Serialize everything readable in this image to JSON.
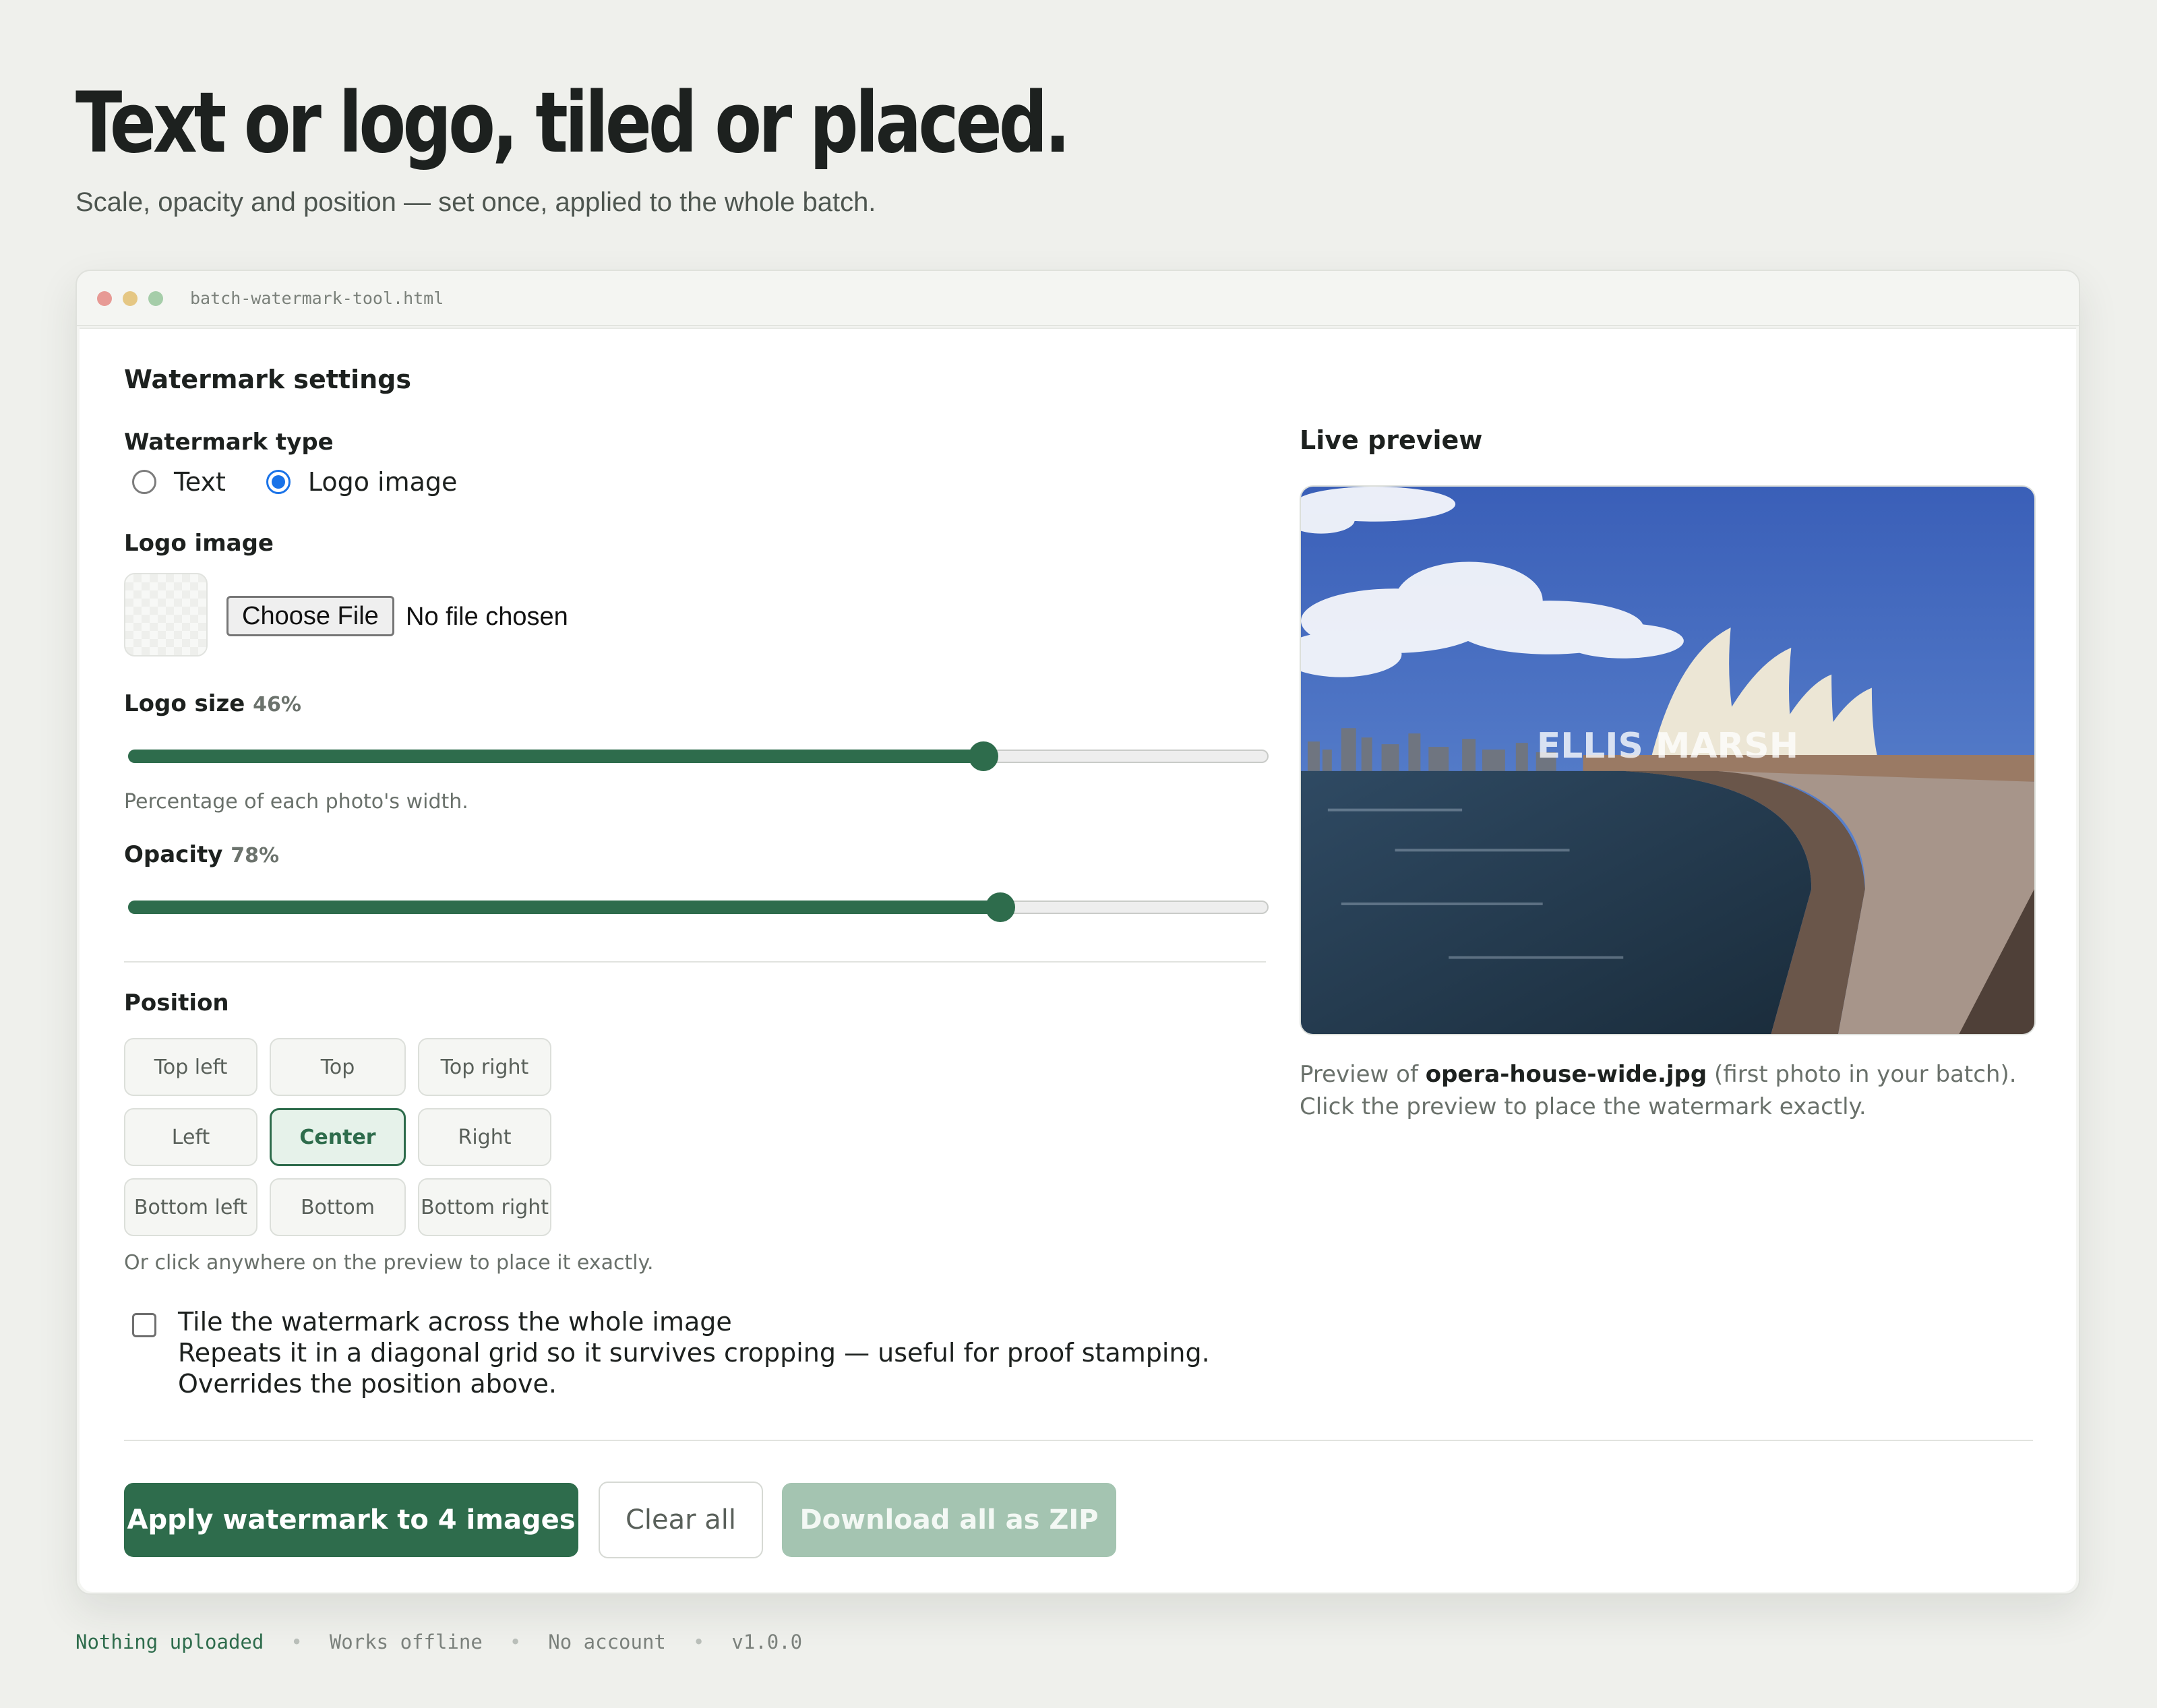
{
  "hero": {
    "title": "Text or logo, tiled or placed.",
    "subtitle": "Scale, opacity and position — set once, applied to the whole batch."
  },
  "window": {
    "title": "batch-watermark-tool.html"
  },
  "settings": {
    "heading": "Watermark settings",
    "type_label": "Watermark type",
    "type_options": [
      {
        "label": "Text",
        "selected": false
      },
      {
        "label": "Logo image",
        "selected": true
      }
    ],
    "logo_label": "Logo image",
    "file_button": "Choose File",
    "file_status": "No file chosen",
    "size_label": "Logo size",
    "size_value": "46%",
    "size_fraction": 0.75,
    "size_help": "Percentage of each photo's width.",
    "opacity_label": "Opacity",
    "opacity_value": "78%",
    "opacity_fraction": 0.765,
    "position_label": "Position",
    "positions": [
      "Top left",
      "Top",
      "Top right",
      "Left",
      "Center",
      "Right",
      "Bottom left",
      "Bottom",
      "Bottom right"
    ],
    "position_selected": "Center",
    "position_help": "Or click anywhere on the preview to place it exactly.",
    "tile_checked": false,
    "tile_title": "Tile the watermark across the whole image",
    "tile_desc": "Repeats it in a diagonal grid so it survives cropping — useful for proof stamping. Overrides the position above."
  },
  "preview": {
    "heading": "Live preview",
    "watermark_text": "ELLIS MARSH",
    "caption_prefix": "Preview of ",
    "caption_file": "opera-house-wide.jpg",
    "caption_suffix": " (first photo in your batch). Click the preview to place the watermark exactly."
  },
  "actions": {
    "apply": "Apply watermark to 4 images",
    "clear": "Clear all",
    "download": "Download all as ZIP"
  },
  "footer": [
    "Nothing uploaded",
    "Works offline",
    "No account",
    "v1.0.0"
  ]
}
